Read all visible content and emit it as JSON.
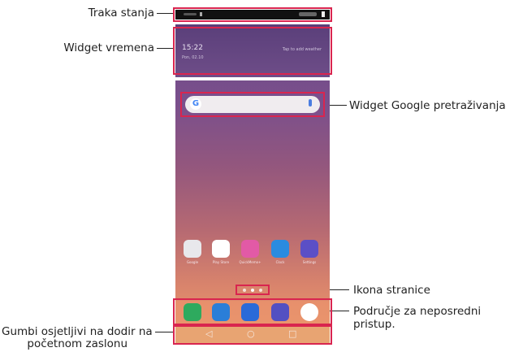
{
  "labels": {
    "status_bar": "Traka stanja",
    "weather_widget": "Widget vremena",
    "google_widget": "Widget Google pretraživanja",
    "page_icon": "Ikona stranice",
    "quick_access_1": "Područje za neposredni",
    "quick_access_2": "pristup.",
    "touch_buttons_1": "Gumbi osjetljivi na dodir na",
    "touch_buttons_2": "početnom zaslonu"
  },
  "weather": {
    "time": "15:22",
    "date": "Pon, 02.10",
    "hint": "Tap to add weather"
  },
  "search": {
    "logo": "G"
  },
  "home_apps": [
    {
      "name": "Google",
      "color": "#e8e8ec"
    },
    {
      "name": "Play Store",
      "color": "#ffffff"
    },
    {
      "name": "QuickMemo+",
      "color": "#e25aa6"
    },
    {
      "name": "Clock",
      "color": "#2a8be0"
    },
    {
      "name": "Settings",
      "color": "#5b4fc6"
    }
  ],
  "dock_apps": [
    {
      "name": "Phone",
      "color": "#2eaa5e"
    },
    {
      "name": "Messages",
      "color": "#2a7ed8"
    },
    {
      "name": "Camera",
      "color": "#2a6ad8"
    },
    {
      "name": "Gallery",
      "color": "#5350c2"
    },
    {
      "name": "Chrome",
      "color": "#ffffff"
    }
  ],
  "nav": {
    "back": "◁",
    "home": "○",
    "recent": "□"
  }
}
